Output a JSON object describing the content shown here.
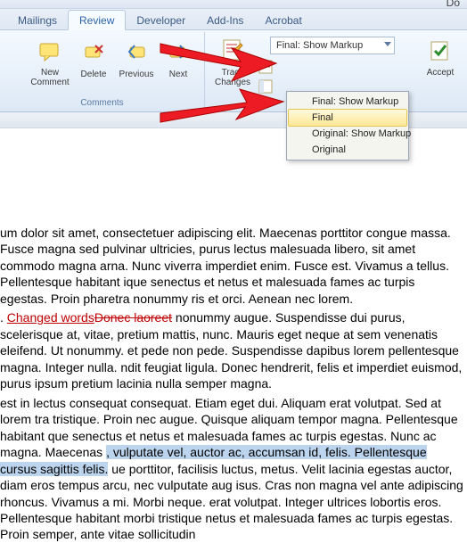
{
  "window": {
    "title_fragment": "Do"
  },
  "tabs": {
    "items": [
      "Mailings",
      "Review",
      "Developer",
      "Add-Ins",
      "Acrobat"
    ],
    "active_index": 1
  },
  "ribbon": {
    "comments_group": {
      "label": "Comments",
      "new_comment": "New\nComment",
      "delete": "Delete",
      "previous": "Previous",
      "next": "Next"
    },
    "tracking_group": {
      "track_changes": "Track\nChanges",
      "display_dropdown": {
        "value": "Final: Show Markup"
      },
      "menu_items": [
        "Final: Show Markup",
        "Final",
        "Original: Show Markup",
        "Original"
      ],
      "menu_hover_index": 1
    },
    "changes_group": {
      "accept": "Accept"
    }
  },
  "document": {
    "p1": "um dolor sit amet, consectetuer adipiscing elit. Maecenas porttitor congue massa. Fusce magna sed pulvinar ultricies, purus lectus malesuada libero, sit amet commodo magna arna. Nunc viverra imperdiet enim. Fusce est. Vivamus a tellus. Pellentesque habitant ique senectus et netus et malesuada fames ac turpis egestas. Proin pharetra nonummy ris et orci. Aenean nec lorem.",
    "p2a": ". ",
    "p2_ins": "Changed words",
    "p2_del": "Donec laoreet",
    "p2b": " nonummy augue. Suspendisse dui purus, scelerisque at, vitae, pretium mattis, nunc. Mauris eget neque at sem venenatis eleifend. Ut nonummy. et pede non pede. Suspendisse dapibus lorem pellentesque magna. Integer nulla. ndit feugiat ligula. Donec hendrerit, felis et imperdiet euismod, purus ipsum pretium lacinia nulla semper magna.",
    "p3a": "est in lectus consequat consequat. Etiam eget dui. Aliquam erat volutpat. Sed at lorem tra tristique. Proin nec augue. Quisque aliquam tempor magna. Pellentesque habitant que senectus et netus et malesuada fames ac turpis egestas. Nunc ac magna. Maecenas ",
    "p3_sel": ", vulputate vel, auctor ac, accumsan id, felis. Pellentesque cursus sagittis felis.",
    "p3b": " ue porttitor, facilisis luctus, metus. Velit lacinia egestas auctor, diam eros tempus arcu, nec vulputate aug isus. Cras non magna vel ante adipiscing rhoncus. Vivamus a mi. Morbi neque. erat volutpat. Integer ultrices lobortis eros. Pellentesque habitant morbi tristique netus et malesuada fames ac turpis egestas. Proin semper, ante vitae sollicitudin"
  }
}
